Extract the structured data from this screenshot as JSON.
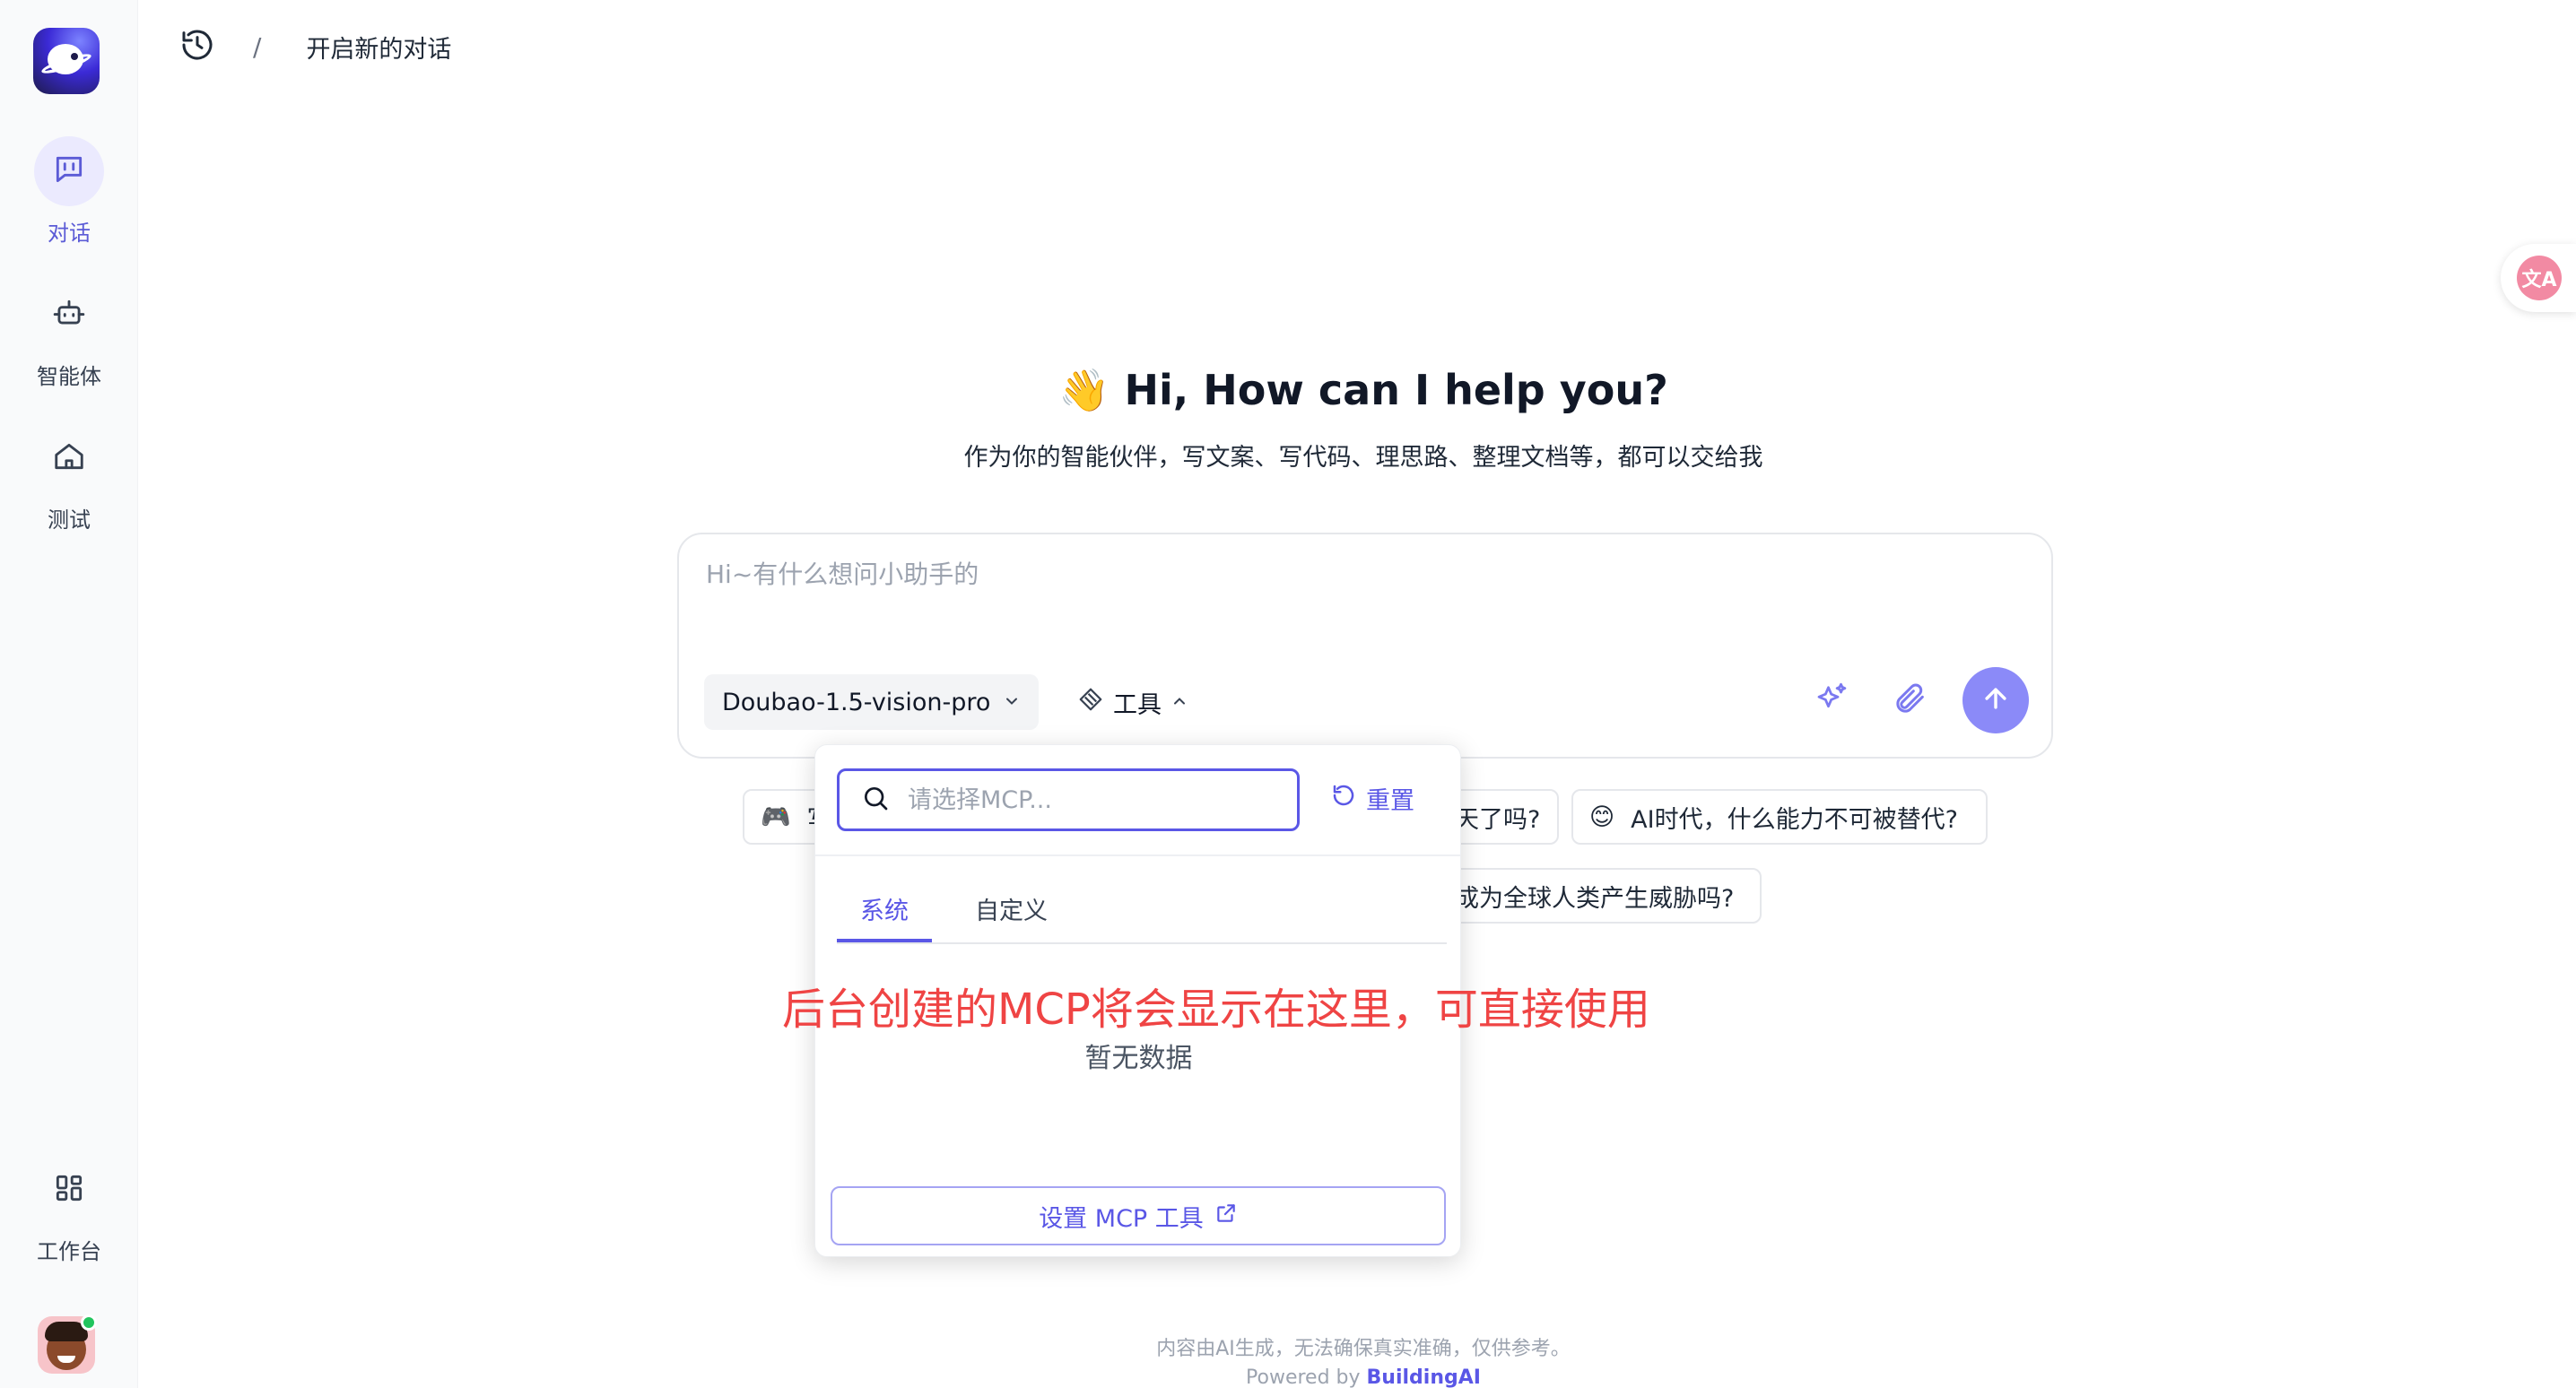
{
  "sidebar": {
    "items": [
      {
        "label": "对话",
        "icon": "chat-icon",
        "active": true
      },
      {
        "label": "智能体",
        "icon": "robot-icon",
        "active": false
      },
      {
        "label": "测试",
        "icon": "home-icon",
        "active": false
      }
    ],
    "workbench": {
      "label": "工作台",
      "icon": "grid-icon"
    }
  },
  "header": {
    "separator": "/",
    "title": "开启新的对话"
  },
  "hero": {
    "emoji": "👋",
    "title": "Hi, How can I help you?",
    "subtitle": "作为你的智能伙伴，写文案、写代码、理思路、整理文档等，都可以交给我"
  },
  "chat": {
    "placeholder": "Hi~有什么想问小助手的",
    "model": "Doubao-1.5-vision-pro",
    "tools_label": "工具"
  },
  "chips": [
    {
      "emoji": "🎮",
      "text": "写"
    },
    {
      "emoji": "",
      "text": "天了吗?"
    },
    {
      "emoji": "😊",
      "text": "AI时代，什么能力不可被替代?"
    },
    {
      "emoji": "",
      "text": "成为全球人类产生威胁吗?"
    }
  ],
  "mcp_popover": {
    "search_placeholder": "请选择MCP...",
    "reset_label": "重置",
    "tabs": [
      "系统",
      "自定义"
    ],
    "active_tab": "系统",
    "empty_text": "暂无数据",
    "config_label": "设置 MCP 工具"
  },
  "annotation": "后台创建的MCP将会显示在这里，可直接使用",
  "footer": {
    "note": "内容由AI生成，无法确保真实准确，仅供参考。",
    "powered_prefix": "Powered by",
    "brand": "BuildingAI"
  },
  "colors": {
    "accent": "#5a57e6",
    "send_button": "#8b8af8",
    "annotation": "#ef4444",
    "online": "#22c55e"
  }
}
